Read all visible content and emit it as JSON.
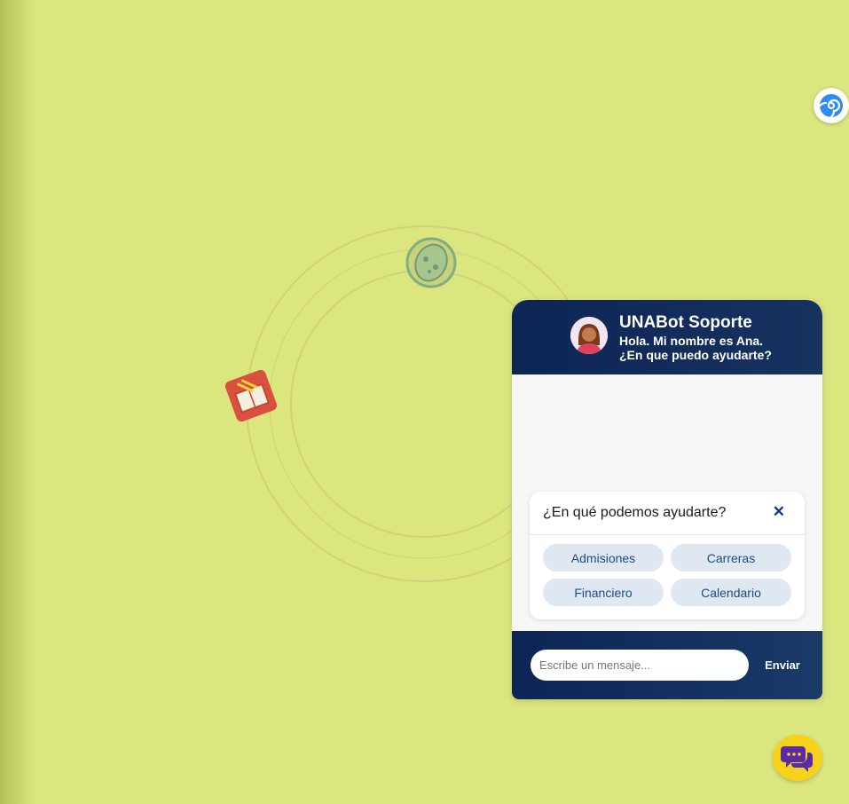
{
  "chatbot": {
    "title": "UNABot Soporte",
    "subtitle_line1": "Hola. Mi nombre es Ana.",
    "subtitle_line2": "¿En que puedo ayudarte?"
  },
  "quick_replies": {
    "title": "¿En qué podemos ayudarte?",
    "close_label": "✕",
    "options": [
      "Admisiones",
      "Carreras",
      "Financiero",
      "Calendario"
    ]
  },
  "composer": {
    "placeholder": "Escribe un mensaje...",
    "send_label": "Enviar"
  },
  "icons": {
    "floating_assist": "spiral-assist-icon",
    "launcher": "chat-bubbles-icon",
    "orbit_top": "potato-sticker-icon",
    "orbit_left": "book-sticker-icon"
  },
  "colors": {
    "background": "#dce67f",
    "header": "#0c2555",
    "quick_button_bg": "#dfe7f1",
    "quick_button_text": "#1e4b86",
    "launcher": "#f6d21a"
  }
}
